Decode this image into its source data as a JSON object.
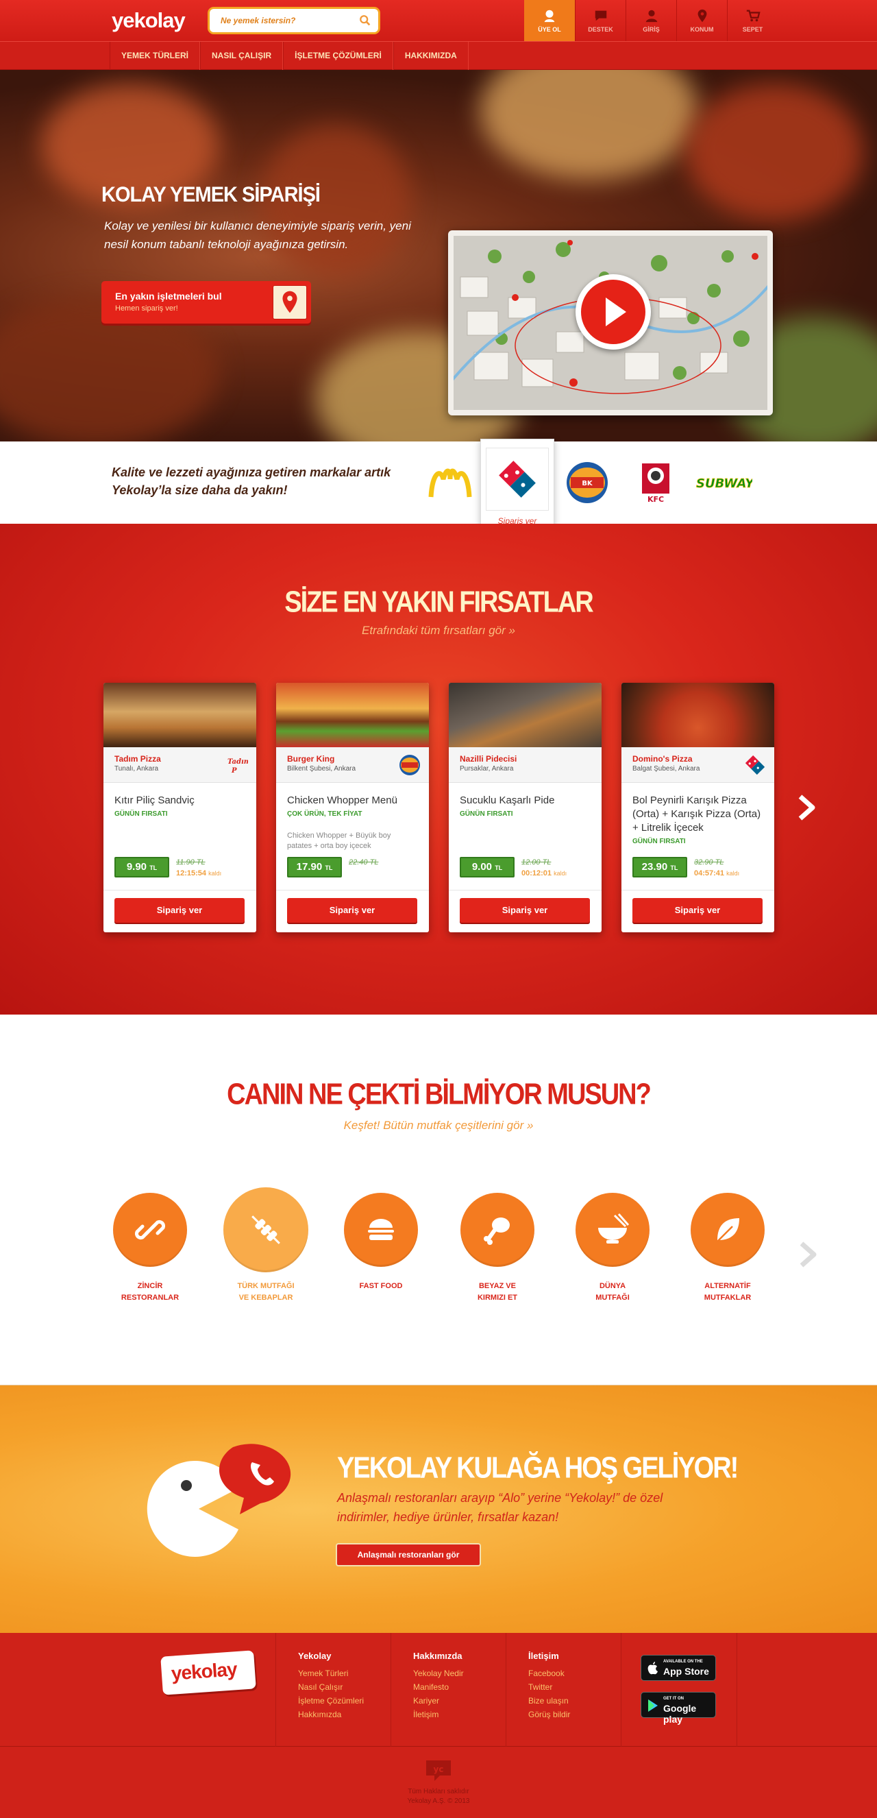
{
  "header": {
    "logo": "yekolay",
    "search_placeholder": "Ne yemek istersin?",
    "tools": [
      {
        "label": "ÜYE OL",
        "icon": "user-add-icon"
      },
      {
        "label": "DESTEK",
        "icon": "chat-icon"
      },
      {
        "label": "GİRİŞ",
        "icon": "user-icon"
      },
      {
        "label": "KONUM",
        "icon": "location-pin-icon"
      },
      {
        "label": "SEPET",
        "icon": "cart-icon"
      }
    ],
    "nav": [
      "YEMEK TÜRLERİ",
      "NASIL ÇALIŞIR",
      "İŞLETME ÇÖZÜMLERİ",
      "HAKKIMIZDA"
    ]
  },
  "hero": {
    "title": "KOLAY YEMEK SİPARİŞİ",
    "text": "Kolay ve yenilesi bir kullanıcı deneyimiyle sipariş verin, yeni nesil konum tabanlı teknoloji ayağınıza getirsin.",
    "cta_title": "En yakın işletmeleri bul",
    "cta_sub": "Hemen sipariş ver!"
  },
  "brands": {
    "text": "Kalite ve lezzeti ayağınıza getiren markalar artık Yekolay’la size daha da yakın!",
    "active_label": "Sipariş ver",
    "logos": [
      "McDonald's",
      "Domino's Pizza",
      "Burger King",
      "KFC",
      "Subway"
    ]
  },
  "deals": {
    "title": "SİZE EN YAKIN FIRSATLAR",
    "sub": "Etrafındaki tüm fırsatları gör »",
    "items": [
      {
        "shop": "Tadım Pizza",
        "loc": "Tunalı, Ankara",
        "name": "Kıtır Piliç Sandviç",
        "tag": "GÜNÜN FIRSATI",
        "desc": "",
        "price": "9.90",
        "old": "11.90 TL",
        "time": "12:15:54",
        "left": "kaldı"
      },
      {
        "shop": "Burger King",
        "loc": "Bilkent Şubesi, Ankara",
        "name": "Chicken Whopper Menü",
        "tag": "ÇOK ÜRÜN, TEK FİYAT",
        "desc": "Chicken Whopper + Büyük boy patates + orta boy içecek",
        "price": "17.90",
        "old": "22.40 TL",
        "time": "",
        "left": ""
      },
      {
        "shop": "Nazilli Pidecisi",
        "loc": "Pursaklar, Ankara",
        "name": "Sucuklu Kaşarlı Pide",
        "tag": "GÜNÜN FIRSATI",
        "desc": "",
        "price": "9.00",
        "old": "12.00 TL",
        "time": "00:12:01",
        "left": "kaldı"
      },
      {
        "shop": "Domino's Pizza",
        "loc": "Balgat Şubesi, Ankara",
        "name": "Bol Peynirli Karışık Pizza (Orta) + Karışık Pizza (Orta) + Litrelik İçecek",
        "tag": "GÜNÜN FIRSATI",
        "desc": "",
        "price": "23.90",
        "old": "32.90 TL",
        "time": "04:57:41",
        "left": "kaldı"
      }
    ],
    "currency": "TL",
    "order_button": "Sipariş ver"
  },
  "mood": {
    "title": "CANIN NE ÇEKTİ BİLMİYOR MUSUN?",
    "sub": "Keşfet! Bütün mutfak çeşitlerini gör »",
    "categories": [
      {
        "label": "ZİNCİR\nRESTORANLAR",
        "icon": "chain-link-icon"
      },
      {
        "label": "TÜRK MUTFAĞI\nVE KEBAPLAR",
        "icon": "kebab-icon"
      },
      {
        "label": "FAST FOOD",
        "icon": "burger-icon"
      },
      {
        "label": "BEYAZ VE\nKIRMIZI ET",
        "icon": "drumstick-icon"
      },
      {
        "label": "DÜNYA\nMUTFAĞI",
        "icon": "noodle-bowl-icon"
      },
      {
        "label": "ALTERNATİF\nMUTFAKLAR",
        "icon": "leaf-icon"
      }
    ]
  },
  "promo": {
    "title": "YEKOLAY KULAĞA HOŞ GELİYOR!",
    "text": "Anlaşmalı restoranları arayıp “Alo” yerine “Yekolay!” de özel indirimler, hediye ürünler, fırsatlar kazan!",
    "button": "Anlaşmalı restoranları gör"
  },
  "footer": {
    "logo": "yekolay",
    "cols": [
      {
        "title": "Yekolay",
        "links": [
          "Yemek Türleri",
          "Nasıl Çalışır",
          "İşletme Çözümleri",
          "Hakkımızda"
        ]
      },
      {
        "title": "Hakkımızda",
        "links": [
          "Yekolay Nedir",
          "Manifesto",
          "Kariyer",
          "İletişim"
        ]
      },
      {
        "title": "İletişim",
        "links": [
          "Facebook",
          "Twitter",
          "Bize ulaşın",
          "Görüş bildir"
        ]
      }
    ],
    "appstore_small": "AVAILABLE ON THE",
    "appstore": "App Store",
    "googleplay_small": "GET IT ON",
    "googleplay": "Google play",
    "copyright1": "Tüm Hakları saklıdır",
    "copyright2": "Yekolay A.Ş. © 2013"
  }
}
